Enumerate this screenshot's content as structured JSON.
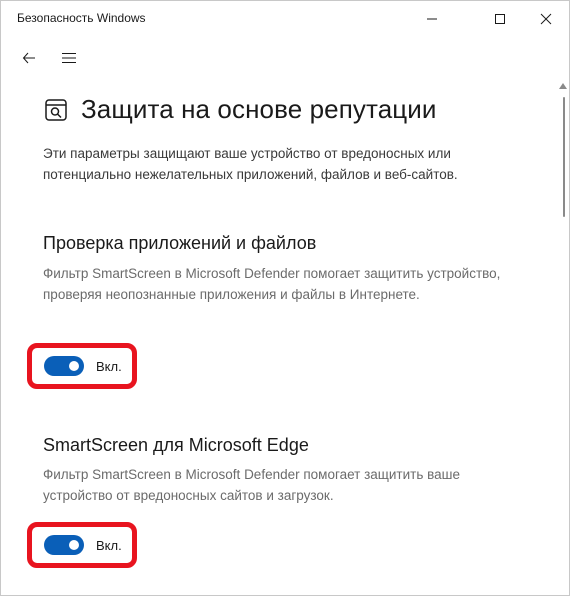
{
  "window": {
    "title": "Безопасность Windows"
  },
  "page": {
    "title": "Защита на основе репутации",
    "description": "Эти параметры защищают ваше устройство от вредоносных или потенциально нежелательных приложений, файлов и веб-сайтов."
  },
  "sections": [
    {
      "title": "Проверка приложений и файлов",
      "description": "Фильтр SmartScreen в Microsoft Defender помогает защитить устройство, проверяя неопознанные приложения и файлы в Интернете.",
      "toggle_label": "Вкл.",
      "toggle_on": true
    },
    {
      "title": "SmartScreen для Microsoft Edge",
      "description": "Фильтр SmartScreen в Microsoft Defender помогает защитить ваше устройство от вредоносных сайтов и загрузок.",
      "toggle_label": "Вкл.",
      "toggle_on": true
    }
  ],
  "colors": {
    "toggle_on": "#0a5fb8",
    "highlight": "#e8141f"
  },
  "icons": {
    "back": "back-arrow-icon",
    "menu": "hamburger-menu-icon",
    "page": "app-browser-control-icon"
  }
}
